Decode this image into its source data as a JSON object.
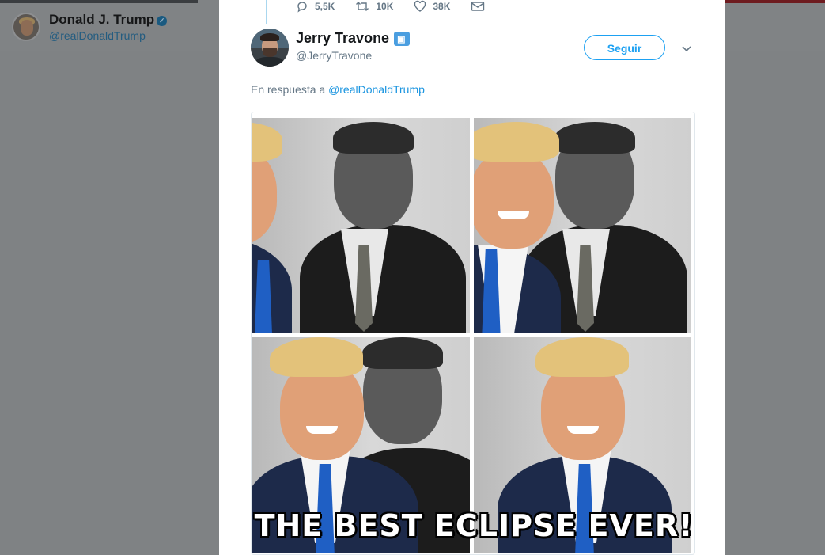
{
  "background_profile": {
    "name": "Donald J. Trump",
    "handle": "@realDonaldTrump",
    "verified_icon": "verified-badge-icon"
  },
  "prev_tweet_actions": {
    "replies": "5,5K",
    "retweets": "10K",
    "likes": "38K"
  },
  "tweet": {
    "author_name": "Jerry Travone",
    "author_handle": "@JerryTravone",
    "author_badge_icon": "profile-badge-icon",
    "follow_label": "Seguir",
    "reply_prefix": "En respuesta a",
    "reply_mention": "@realDonaldTrump",
    "image": {
      "caption": "THE BEST ECLIPSE EVER!"
    }
  },
  "colors": {
    "accent": "#1da1f2",
    "mention": "#1b95e0",
    "muted": "#657786"
  }
}
